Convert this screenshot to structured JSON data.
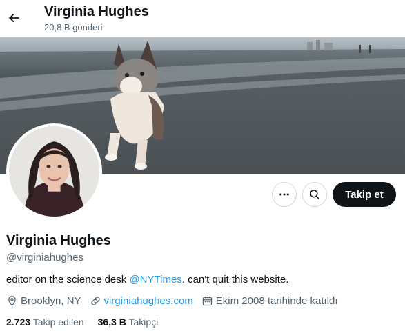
{
  "header": {
    "name": "Virginia Hughes",
    "post_count": "20,8 B gönderi"
  },
  "profile": {
    "display_name": "Virginia Hughes",
    "handle": "@virginiahughes",
    "bio_before": "editor on the science desk ",
    "bio_mention": "@NYTimes",
    "bio_after": ". can't quit this website.",
    "location": "Brooklyn, NY",
    "website": "virginiahughes.com",
    "joined": "Ekim 2008 tarihinde katıldı"
  },
  "actions": {
    "follow_label": "Takip et",
    "more_icon": "more-icon",
    "search_icon": "search-icon"
  },
  "stats": {
    "following_count": "2.723",
    "following_label": "Takip edilen",
    "followers_count": "36,3 B",
    "followers_label": "Takipçi"
  },
  "colors": {
    "accent": "#1d9bf0",
    "text_primary": "#0f1419",
    "text_secondary": "#536471",
    "follow_button_bg": "#0f1419"
  }
}
